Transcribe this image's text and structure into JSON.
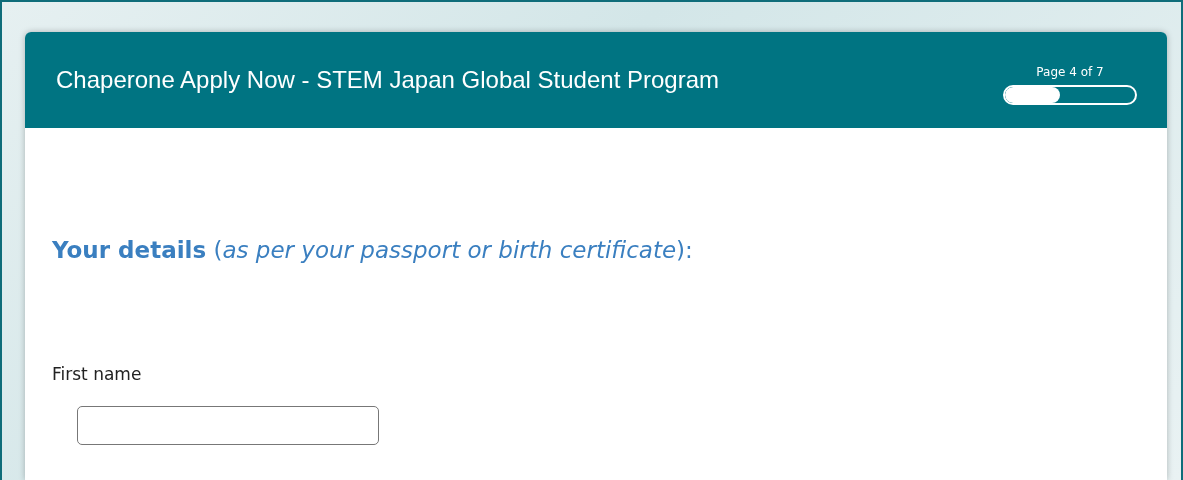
{
  "form": {
    "title": "Chaperone Apply Now - STEM Japan Global Student Program",
    "progress": {
      "label": "Page 4 of 7",
      "level": 0.42
    }
  },
  "section": {
    "heading": "**Your details** (*as per your passport or birth certificate*):",
    "fields": [
      {
        "label": "First name"
      }
    ]
  }
}
